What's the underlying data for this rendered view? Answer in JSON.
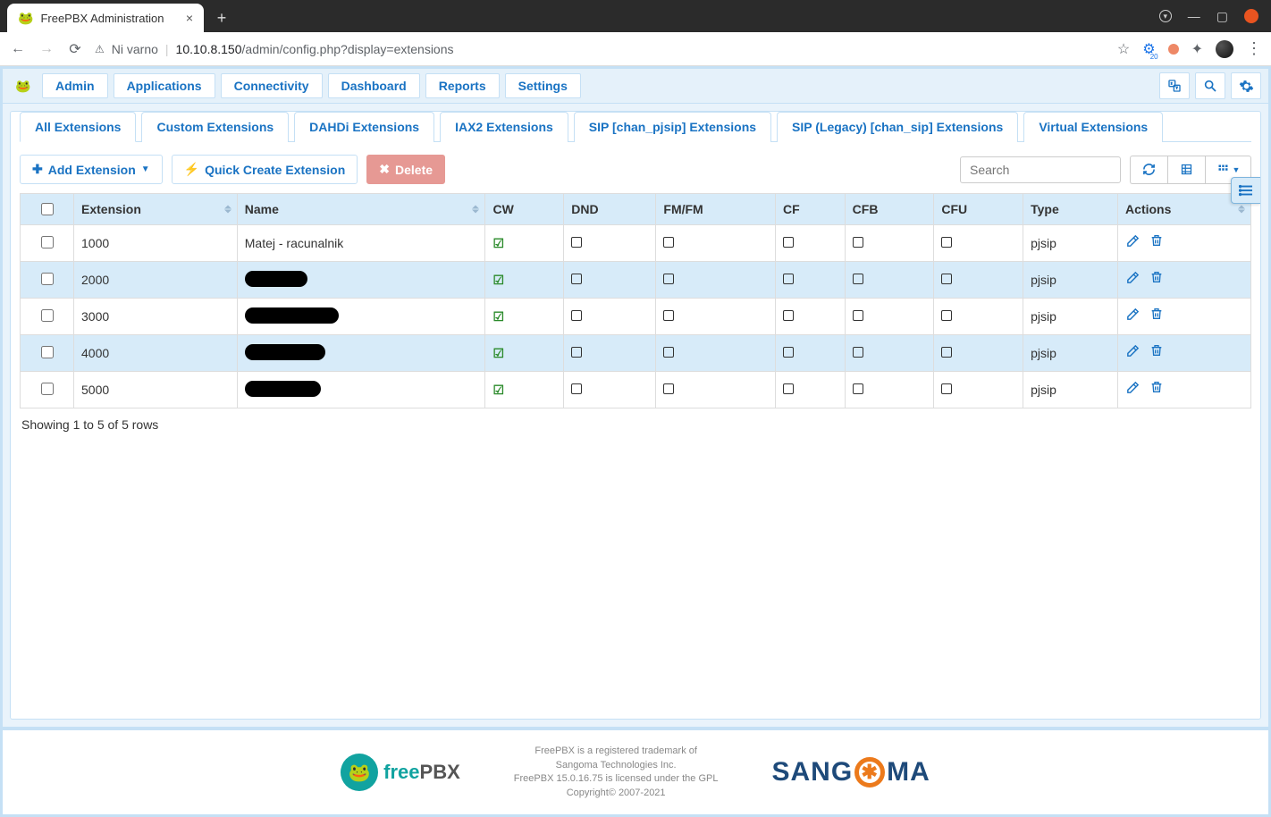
{
  "browser": {
    "tab_title": "FreePBX Administration",
    "security_label": "Ni varno",
    "url_host": "10.10.8.150",
    "url_path": "/admin/config.php?display=extensions",
    "ext_badge_count": "20"
  },
  "toolbar": {
    "items": [
      "Admin",
      "Applications",
      "Connectivity",
      "Dashboard",
      "Reports",
      "Settings"
    ]
  },
  "tabs": [
    {
      "label": "All Extensions",
      "active": true
    },
    {
      "label": "Custom Extensions",
      "active": false
    },
    {
      "label": "DAHDi Extensions",
      "active": false
    },
    {
      "label": "IAX2 Extensions",
      "active": false
    },
    {
      "label": "SIP [chan_pjsip] Extensions",
      "active": false
    },
    {
      "label": "SIP (Legacy) [chan_sip] Extensions",
      "active": false
    },
    {
      "label": "Virtual Extensions",
      "active": false
    }
  ],
  "buttons": {
    "add": "Add Extension",
    "quick": "Quick Create Extension",
    "delete": "Delete"
  },
  "search_placeholder": "Search",
  "columns": [
    "",
    "Extension",
    "Name",
    "CW",
    "DND",
    "FM/FM",
    "CF",
    "CFB",
    "CFU",
    "Type",
    "Actions"
  ],
  "rows": [
    {
      "ext": "1000",
      "name": "Matej - racunalnik",
      "redacted": false,
      "redact_w": 0,
      "cw": true,
      "dnd": false,
      "fmfm": false,
      "cf": false,
      "cfb": false,
      "cfu": false,
      "type": "pjsip"
    },
    {
      "ext": "2000",
      "name": "",
      "redacted": true,
      "redact_w": 70,
      "cw": true,
      "dnd": false,
      "fmfm": false,
      "cf": false,
      "cfb": false,
      "cfu": false,
      "type": "pjsip"
    },
    {
      "ext": "3000",
      "name": "",
      "redacted": true,
      "redact_w": 105,
      "cw": true,
      "dnd": false,
      "fmfm": false,
      "cf": false,
      "cfb": false,
      "cfu": false,
      "type": "pjsip"
    },
    {
      "ext": "4000",
      "name": "",
      "redacted": true,
      "redact_w": 90,
      "cw": true,
      "dnd": false,
      "fmfm": false,
      "cf": false,
      "cfb": false,
      "cfu": false,
      "type": "pjsip"
    },
    {
      "ext": "5000",
      "name": "",
      "redacted": true,
      "redact_w": 85,
      "cw": true,
      "dnd": false,
      "fmfm": false,
      "cf": false,
      "cfb": false,
      "cfu": false,
      "type": "pjsip"
    }
  ],
  "paging": "Showing 1 to 5 of 5 rows",
  "footer": {
    "line1": "FreePBX is a registered trademark of",
    "line2": "Sangoma Technologies Inc.",
    "line3": "FreePBX 15.0.16.75 is licensed under the GPL",
    "line4": "Copyright© 2007-2021",
    "logo_free": "free",
    "logo_pbx": "PBX",
    "sangoma_pre": "SANG",
    "sangoma_post": "MA"
  }
}
